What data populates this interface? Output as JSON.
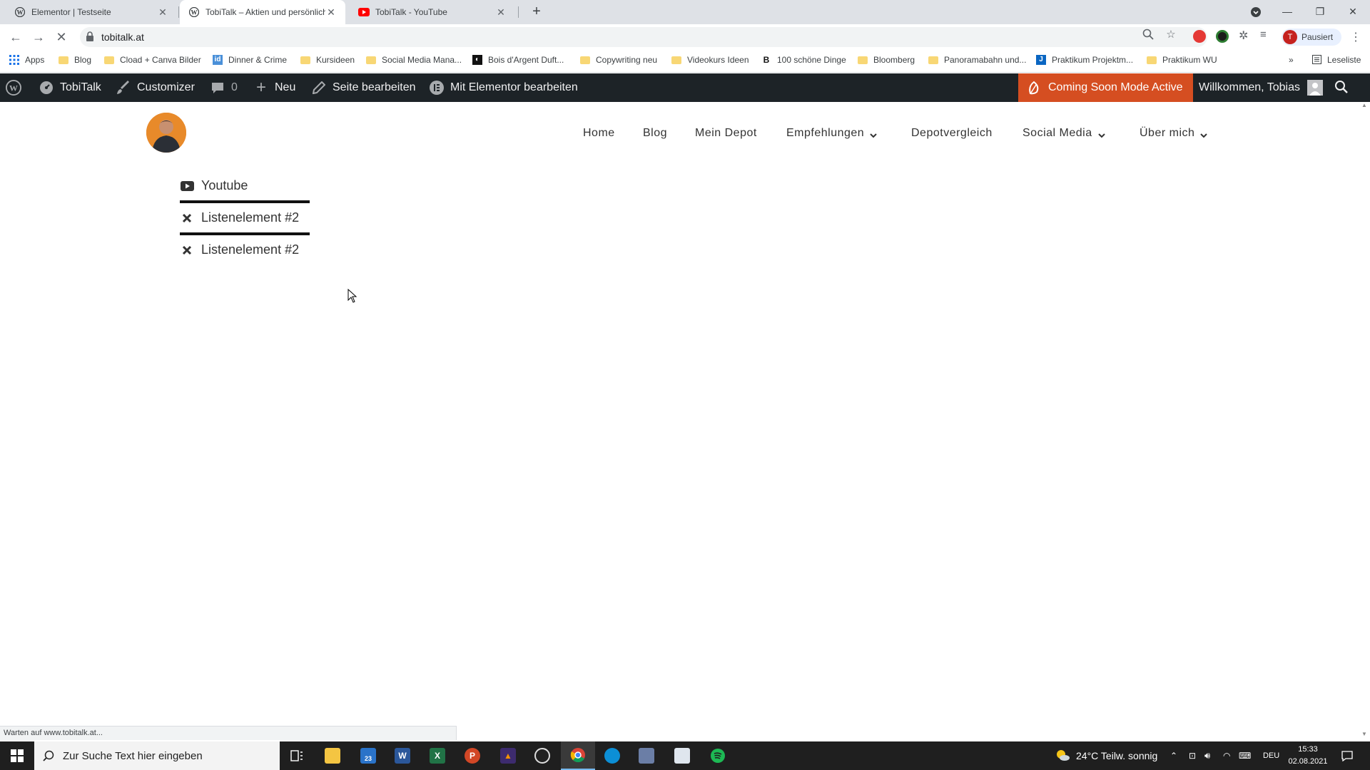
{
  "browser": {
    "tabs": [
      {
        "title": "Elementor | Testseite",
        "icon": "wordpress-icon"
      },
      {
        "title": "TobiTalk – Aktien und persönliche",
        "icon": "wordpress-icon"
      },
      {
        "title": "TobiTalk - YouTube",
        "icon": "youtube-icon"
      }
    ],
    "url": "tobitalk.at",
    "profile_status": "Pausiert",
    "profile_initial": "T",
    "status_text": "Warten auf www.tobitalk.at..."
  },
  "bookmarks": [
    "Apps",
    "Blog",
    "Cload + Canva Bilder",
    "Dinner & Crime",
    "Kursideen",
    "Social Media Mana...",
    "Bois d'Argent Duft...",
    "Copywriting neu",
    "Videokurs Ideen",
    "100 schöne Dinge",
    "Bloomberg",
    "Panoramabahn und...",
    "Praktikum Projektm...",
    "Praktikum WU"
  ],
  "reading_list": "Leseliste",
  "adminbar": {
    "site": "TobiTalk",
    "customizer": "Customizer",
    "comments_count": "0",
    "new": "Neu",
    "edit_page": "Seite bearbeiten",
    "elementor": "Mit Elementor bearbeiten",
    "coming_soon": "Coming Soon Mode Active",
    "welcome": "Willkommen, Tobias"
  },
  "menu": {
    "items": [
      "Home",
      "Blog",
      "Mein Depot",
      "Empfehlungen",
      "Depotvergleich",
      "Social Media",
      "Über mich"
    ]
  },
  "icon_list": {
    "items": [
      {
        "label": "Youtube",
        "icon": "youtube-icon"
      },
      {
        "label": "Listenelement #2",
        "icon": "times-icon"
      },
      {
        "label": "Listenelement #2",
        "icon": "times-icon"
      }
    ]
  },
  "taskbar": {
    "search_placeholder": "Zur Suche Text hier eingeben",
    "mail_badge": "23",
    "weather": "24°C  Teilw. sonnig",
    "language": "DEU",
    "time": "15:33",
    "date": "02.08.2021"
  },
  "colors": {
    "adminbar_bg": "#1d2327",
    "coming_soon_bg": "#d54e21",
    "tabstrip_bg": "#dee1e6"
  }
}
